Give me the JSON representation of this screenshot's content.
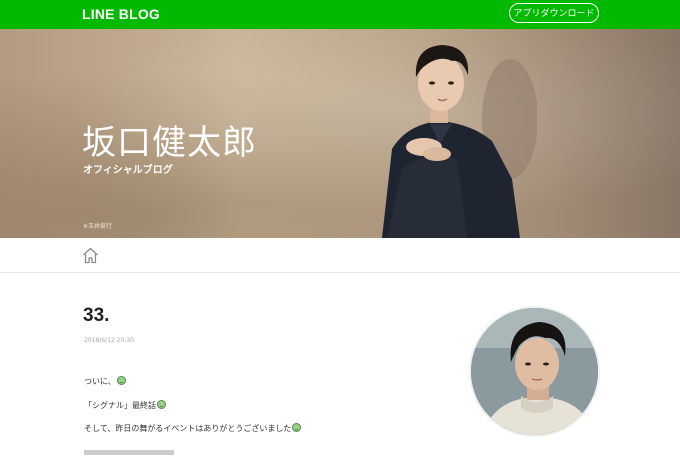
{
  "header": {
    "logo": "LINE BLOG",
    "download_button": "アプリダウンロード"
  },
  "hero": {
    "title": "坂口健太郎",
    "subtitle": "オフィシャルブログ",
    "credit": "※玉井俊行"
  },
  "nav": {
    "home_icon": "home-icon"
  },
  "post": {
    "title": "33.",
    "date": "2018/6/12 20:30",
    "lines": [
      "ついに、",
      "「シグナル」最終話",
      "そして、昨日の舞がるイベントはありがとうございました"
    ]
  },
  "colors": {
    "brand": "#00b900"
  }
}
